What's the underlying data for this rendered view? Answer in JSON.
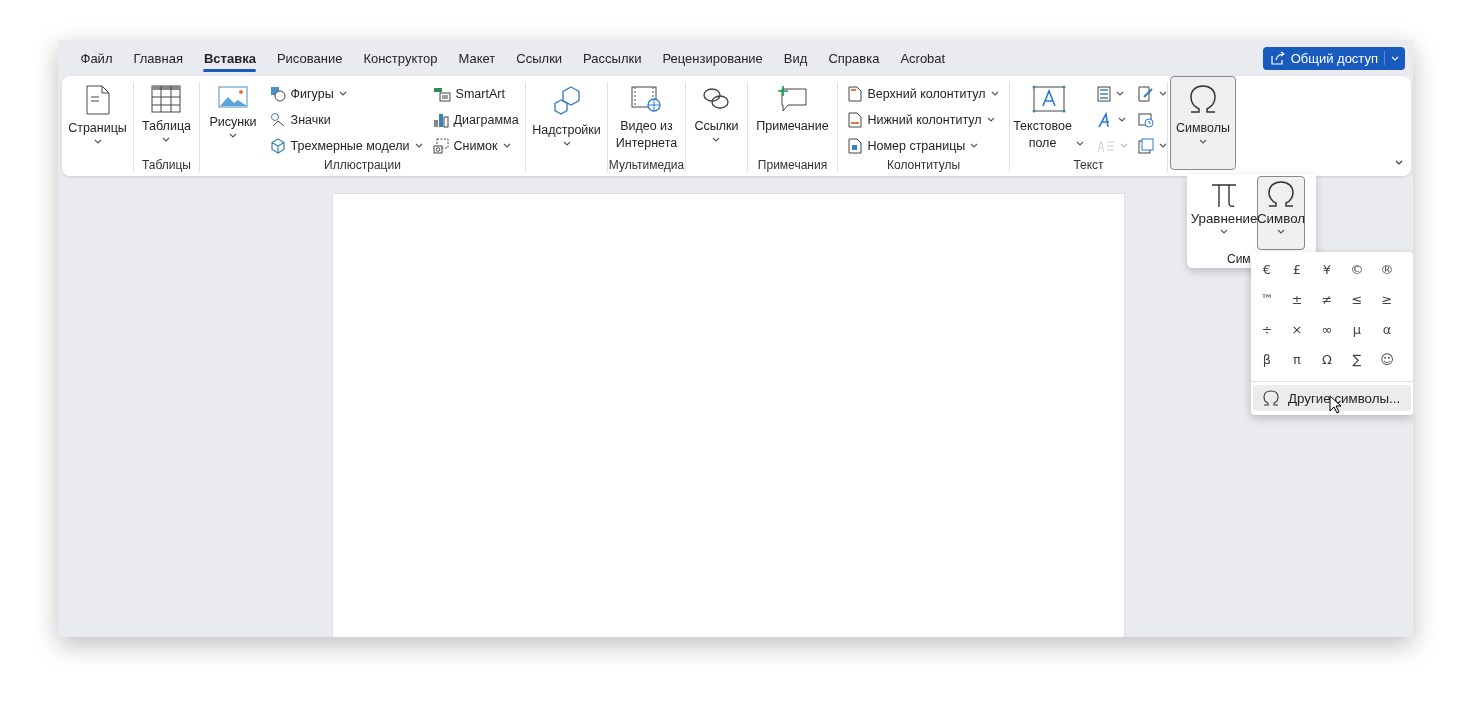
{
  "tabs": [
    {
      "label": "Файл",
      "selected": false
    },
    {
      "label": "Главная",
      "selected": false
    },
    {
      "label": "Вставка",
      "selected": true
    },
    {
      "label": "Рисование",
      "selected": false
    },
    {
      "label": "Конструктор",
      "selected": false
    },
    {
      "label": "Макет",
      "selected": false
    },
    {
      "label": "Ссылки",
      "selected": false
    },
    {
      "label": "Рассылки",
      "selected": false
    },
    {
      "label": "Рецензирование",
      "selected": false
    },
    {
      "label": "Вид",
      "selected": false
    },
    {
      "label": "Справка",
      "selected": false
    },
    {
      "label": "Acrobat",
      "selected": false
    }
  ],
  "share_button": {
    "label": "Общий доступ"
  },
  "ribbon": {
    "groups": [
      {
        "items": [
          {
            "kind": "large",
            "label": "Страницы",
            "dropdown": true,
            "pressed": false
          }
        ]
      },
      {
        "label": "Таблицы",
        "items": [
          {
            "kind": "large",
            "label": "Таблица",
            "dropdown": true,
            "pressed": false
          }
        ]
      },
      {
        "label": "Иллюстрации",
        "items": [
          {
            "kind": "large",
            "label": "Рисунки",
            "dropdown": true,
            "pressed": false
          },
          {
            "kind": "stack",
            "entries": [
              {
                "label": "Фигуры",
                "dropdown": true,
                "disabled": false
              },
              {
                "label": "Значки",
                "dropdown": false,
                "disabled": false
              },
              {
                "label": "Трехмерные модели",
                "dropdown": true,
                "disabled": false
              }
            ]
          },
          {
            "kind": "stack",
            "entries": [
              {
                "label": "SmartArt",
                "dropdown": false,
                "disabled": false
              },
              {
                "label": "Диаграмма",
                "dropdown": false,
                "disabled": false
              },
              {
                "label": "Снимок",
                "dropdown": true,
                "disabled": false
              }
            ]
          }
        ]
      },
      {
        "items": [
          {
            "kind": "large",
            "label": "Надстройки",
            "dropdown": true,
            "pressed": false
          }
        ]
      },
      {
        "label": "Мультимедиа",
        "items": [
          {
            "kind": "large",
            "label": "Видео из\nИнтернета",
            "dropdown": false,
            "pressed": false
          }
        ]
      },
      {
        "items": [
          {
            "kind": "large",
            "label": "Ссылки",
            "dropdown": true,
            "pressed": false
          }
        ]
      },
      {
        "label": "Примечания",
        "items": [
          {
            "kind": "large",
            "label": "Примечание",
            "dropdown": false,
            "pressed": false
          }
        ]
      },
      {
        "label": "Колонтитулы",
        "items": [
          {
            "kind": "stack",
            "entries": [
              {
                "label": "Верхний колонтитул",
                "dropdown": true,
                "disabled": false
              },
              {
                "label": "Нижний колонтитул",
                "dropdown": true,
                "disabled": false
              },
              {
                "label": "Номер страницы",
                "dropdown": true,
                "disabled": false
              }
            ]
          }
        ]
      },
      {
        "label": "Текст",
        "items": [
          {
            "kind": "large",
            "label": "Текстовое\nполе",
            "dropdown": true,
            "pressed": false
          },
          {
            "kind": "stack",
            "entries": [
              {
                "dropdown": true,
                "disabled": false
              },
              {
                "dropdown": true,
                "disabled": false
              },
              {
                "dropdown": true,
                "disabled": true
              }
            ]
          },
          {
            "kind": "stack",
            "entries": [
              {
                "dropdown": true,
                "disabled": false
              },
              {
                "dropdown": false,
                "disabled": false
              },
              {
                "dropdown": true,
                "disabled": false
              }
            ]
          }
        ]
      },
      {
        "items": [
          {
            "kind": "large",
            "label": "Символы",
            "dropdown": true,
            "pressed": true
          }
        ]
      }
    ]
  },
  "symbols_popup": {
    "items": [
      {
        "label": "Уравнение",
        "dropdown": true,
        "pressed": false
      },
      {
        "label": "Символ",
        "dropdown": true,
        "pressed": true
      }
    ],
    "group_label": "Сим"
  },
  "symbol_gallery": {
    "symbols": [
      "€",
      "£",
      "¥",
      "©",
      "®",
      "™",
      "±",
      "≠",
      "≤",
      "≥",
      "÷",
      "×",
      "∞",
      "µ",
      "α",
      "β",
      "π",
      "Ω",
      "∑",
      "☺"
    ],
    "more_button": {
      "label": "Другие символы...",
      "hovered": true
    }
  }
}
